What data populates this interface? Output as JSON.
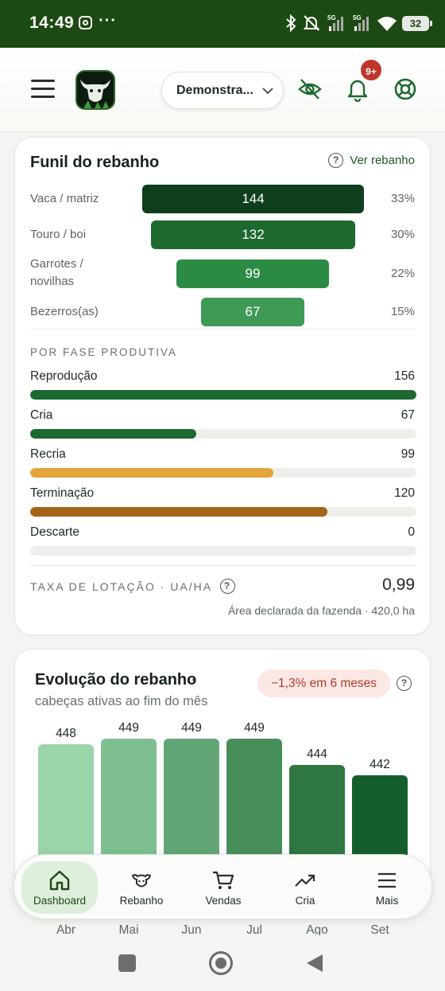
{
  "status_bar": {
    "time": "14:49",
    "notification_icons": [
      "instagram-icon",
      "more-icon"
    ],
    "system_icons": [
      "bluetooth-icon",
      "mute-icon",
      "signal-5g-icon",
      "signal-5g-icon",
      "wifi-icon"
    ],
    "battery": "32"
  },
  "header": {
    "farm_selector": "Demonstra...",
    "notification_badge": "9+",
    "icons": [
      "menu-icon",
      "bull-logo",
      "chevron-down-icon",
      "eye-off-icon",
      "bell-icon",
      "lifebuoy-icon"
    ]
  },
  "funnel": {
    "title": "Funil do rebanho",
    "link_label": "Ver rebanho",
    "rows": [
      {
        "label": "Vaca / matriz",
        "value": "144",
        "pct": "33%",
        "color": "#0f3e1c"
      },
      {
        "label": "Touro / boi",
        "value": "132",
        "pct": "30%",
        "color": "#1d6a31"
      },
      {
        "label": "Garrotes / novilhas",
        "value": "99",
        "pct": "22%",
        "color": "#2b8b45"
      },
      {
        "label": "Bezerros(as)",
        "value": "67",
        "pct": "15%",
        "color": "#3f9a57"
      }
    ],
    "phase_heading": "POR FASE PRODUTIVA",
    "phases": [
      {
        "label": "Reprodução",
        "value": "156",
        "fraction": 1.0,
        "color": "#1d6a31"
      },
      {
        "label": "Cria",
        "value": "67",
        "fraction": 0.43,
        "color": "#1d6a31"
      },
      {
        "label": "Recria",
        "value": "99",
        "fraction": 0.63,
        "color": "#e3a43a"
      },
      {
        "label": "Terminação",
        "value": "120",
        "fraction": 0.77,
        "color": "#a36417"
      },
      {
        "label": "Descarte",
        "value": "0",
        "fraction": 0.0,
        "color": "#1d6a31"
      }
    ],
    "stocking_label": "TAXA DE LOTAÇÃO · UA/HA",
    "stocking_value": "0,99",
    "area_note": "Área declarada da fazenda · 420,0 ha"
  },
  "evolution": {
    "title": "Evolução do rebanho",
    "title_separator": "·",
    "subtitle": "cabeças ativas ao fim do mês",
    "change_pill": "−1,3% em 6 meses"
  },
  "chart_data": {
    "type": "bar",
    "categories": [
      "Abr",
      "Mai",
      "Jun",
      "Jul",
      "Ago",
      "Set"
    ],
    "values": [
      448,
      449,
      449,
      449,
      444,
      442
    ],
    "colors": [
      "#9bd4a8",
      "#7dbf8e",
      "#62a675",
      "#478e5b",
      "#2e7642",
      "#145e2c"
    ],
    "title": "Evolução do rebanho",
    "subtitle": "cabeças ativas ao fim do mês"
  },
  "bottom_nav": [
    {
      "label": "Dashboard",
      "icon": "home-icon",
      "active": true
    },
    {
      "label": "Rebanho",
      "icon": "cow-icon",
      "active": false
    },
    {
      "label": "Vendas",
      "icon": "cart-icon",
      "active": false
    },
    {
      "label": "Cria",
      "icon": "trending-up-icon",
      "active": false
    },
    {
      "label": "Mais",
      "icon": "menu-icon",
      "active": false
    }
  ],
  "system_nav": [
    "recents-button",
    "home-button",
    "back-button"
  ]
}
